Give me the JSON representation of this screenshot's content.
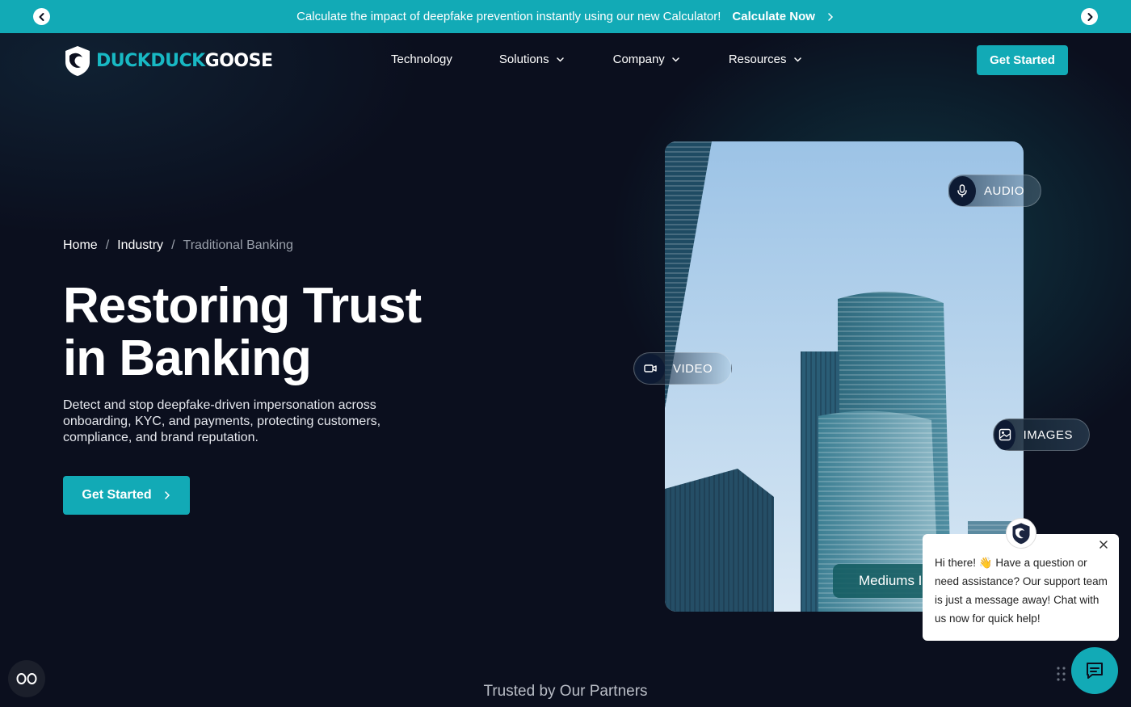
{
  "announcement": {
    "message": "Calculate the impact of deepfake prevention instantly using our new Calculator!",
    "cta_label": "Calculate Now"
  },
  "header": {
    "logo": {
      "part1": "DUCKDUCK",
      "part2": "GOOSE"
    },
    "nav": [
      {
        "label": "Technology",
        "has_dropdown": false
      },
      {
        "label": "Solutions",
        "has_dropdown": true
      },
      {
        "label": "Company",
        "has_dropdown": true
      },
      {
        "label": "Resources",
        "has_dropdown": true
      }
    ],
    "cta_label": "Get Started"
  },
  "breadcrumb": {
    "home": "Home",
    "sep1": "/",
    "industry": "Industry",
    "sep2": "/",
    "current": "Traditional Banking"
  },
  "hero": {
    "title_line1": "Restoring Trust",
    "title_line2": "in Banking",
    "description": "Detect and stop deepfake-driven impersonation across onboarding, KYC, and payments, protecting customers, compliance, and brand reputation.",
    "cta_label": "Get Started"
  },
  "media_badges": {
    "audio": "AUDIO",
    "video": "VIDEO",
    "images": "IMAGES",
    "mediums": "Mediums I"
  },
  "chat": {
    "message": "Hi there! 👋 Have a question or need assistance? Our support team is just a message away! Chat with us now for quick help!"
  },
  "footer_teaser": "Trusted by Our Partners",
  "colors": {
    "accent": "#12aab6",
    "background": "#0b0f1e",
    "icon_circle": "#0d1a33"
  },
  "icons": {
    "announce_prev": "chevron-left-icon",
    "announce_next": "chevron-right-icon",
    "audio": "microphone-icon",
    "video": "video-camera-icon",
    "images": "image-icon",
    "chat_fab": "chat-bubble-icon",
    "accessibility": "accessibility-icon"
  }
}
